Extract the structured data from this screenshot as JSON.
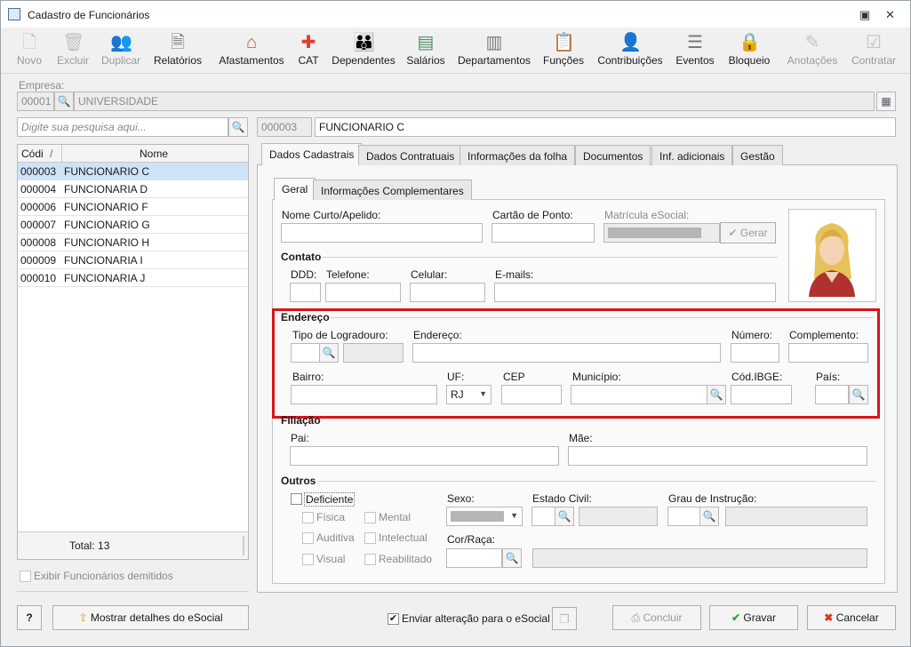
{
  "window": {
    "title": "Cadastro de Funcionários"
  },
  "toolbar": {
    "items": [
      {
        "label": "Novo",
        "icon": "new-file-icon",
        "enabled": false
      },
      {
        "label": "Excluir",
        "icon": "trash-icon",
        "enabled": false
      },
      {
        "label": "Duplicar",
        "icon": "users-icon",
        "enabled": false
      },
      {
        "label": "Relatórios",
        "icon": "report-icon",
        "enabled": true
      },
      {
        "label": "Afastamentos",
        "icon": "house-icon",
        "enabled": true
      },
      {
        "label": "CAT",
        "icon": "medical-cross-icon",
        "enabled": true
      },
      {
        "label": "Dependentes",
        "icon": "family-icon",
        "enabled": true
      },
      {
        "label": "Salários",
        "icon": "money-icon",
        "enabled": true
      },
      {
        "label": "Departamentos",
        "icon": "desk-icon",
        "enabled": true
      },
      {
        "label": "Funções",
        "icon": "clipboard-icon",
        "enabled": true
      },
      {
        "label": "Contribuições",
        "icon": "people-icon",
        "enabled": true
      },
      {
        "label": "Eventos",
        "icon": "list-icon",
        "enabled": true
      },
      {
        "label": "Bloqueio",
        "icon": "lock-icon",
        "enabled": true
      },
      {
        "label": "Anotações",
        "icon": "note-icon",
        "enabled": false
      },
      {
        "label": "Contratar",
        "icon": "contract-icon",
        "enabled": false
      }
    ]
  },
  "empresa": {
    "label": "Empresa:",
    "code": "00001",
    "name": "UNIVERSIDADE"
  },
  "search": {
    "placeholder": "Digite sua pesquisa aqui..."
  },
  "current": {
    "code": "000003",
    "name": "FUNCIONARIO C"
  },
  "grid": {
    "col_code": "Códi",
    "col_name": "Nome",
    "rows": [
      {
        "code": "000003",
        "name": "FUNCIONARIO C"
      },
      {
        "code": "000004",
        "name": "FUNCIONARIA D"
      },
      {
        "code": "000006",
        "name": "FUNCIONARIO F"
      },
      {
        "code": "000007",
        "name": "FUNCIONARIO G"
      },
      {
        "code": "000008",
        "name": "FUNCIONARIO H"
      },
      {
        "code": "000009",
        "name": "FUNCIONARIA I"
      },
      {
        "code": "000010",
        "name": "FUNCIONARIA J"
      }
    ],
    "total": "Total: 13"
  },
  "show_dismissed": "Exibir Funcionários demitidos",
  "tabs": [
    "Dados Cadastrais",
    "Dados Contratuais",
    "Informações da folha",
    "Documentos",
    "Inf. adicionais",
    "Gestão"
  ],
  "subtabs": [
    "Geral",
    "Informações Complementares"
  ],
  "form": {
    "nome_curto": "Nome Curto/Apelido:",
    "cartao": "Cartão de Ponto:",
    "matricula": "Matrícula eSocial:",
    "gerar": "Gerar",
    "contato": "Contato",
    "ddd": "DDD:",
    "telefone": "Telefone:",
    "celular": "Celular:",
    "emails": "E-mails:",
    "endereco_sec": "Endereço",
    "tipo_logradouro": "Tipo de Logradouro:",
    "endereco": "Endereço:",
    "numero": "Número:",
    "complemento": "Complemento:",
    "bairro": "Bairro:",
    "uf": "UF:",
    "uf_value": "RJ",
    "cep": "CEP",
    "municipio": "Município:",
    "cod_ibge": "Cód.IBGE:",
    "pais": "País:",
    "filiacao": "Filiação",
    "pai": "Pai:",
    "mae": "Mãe:",
    "outros": "Outros",
    "deficiente": "Deficiente",
    "fisica": "Física",
    "mental": "Mental",
    "auditiva": "Auditiva",
    "intelectual": "Intelectual",
    "visual": "Visual",
    "reabilitado": "Reabilitado",
    "sexo": "Sexo:",
    "estado_civil": "Estado Civil:",
    "grau": "Grau de Instrução:",
    "cor_raca": "Cor/Raça:"
  },
  "footer": {
    "help": "?",
    "esocial_details": "Mostrar detalhes do eSocial",
    "send_change": "Enviar alteração para o eSocial",
    "concluir": "Concluir",
    "gravar": "Gravar",
    "cancelar": "Cancelar"
  },
  "colors": {
    "highlight": "#d8141b",
    "selected_row": "#cfe3f7",
    "ok": "#3aa23a",
    "cancel": "#d23a1e"
  }
}
